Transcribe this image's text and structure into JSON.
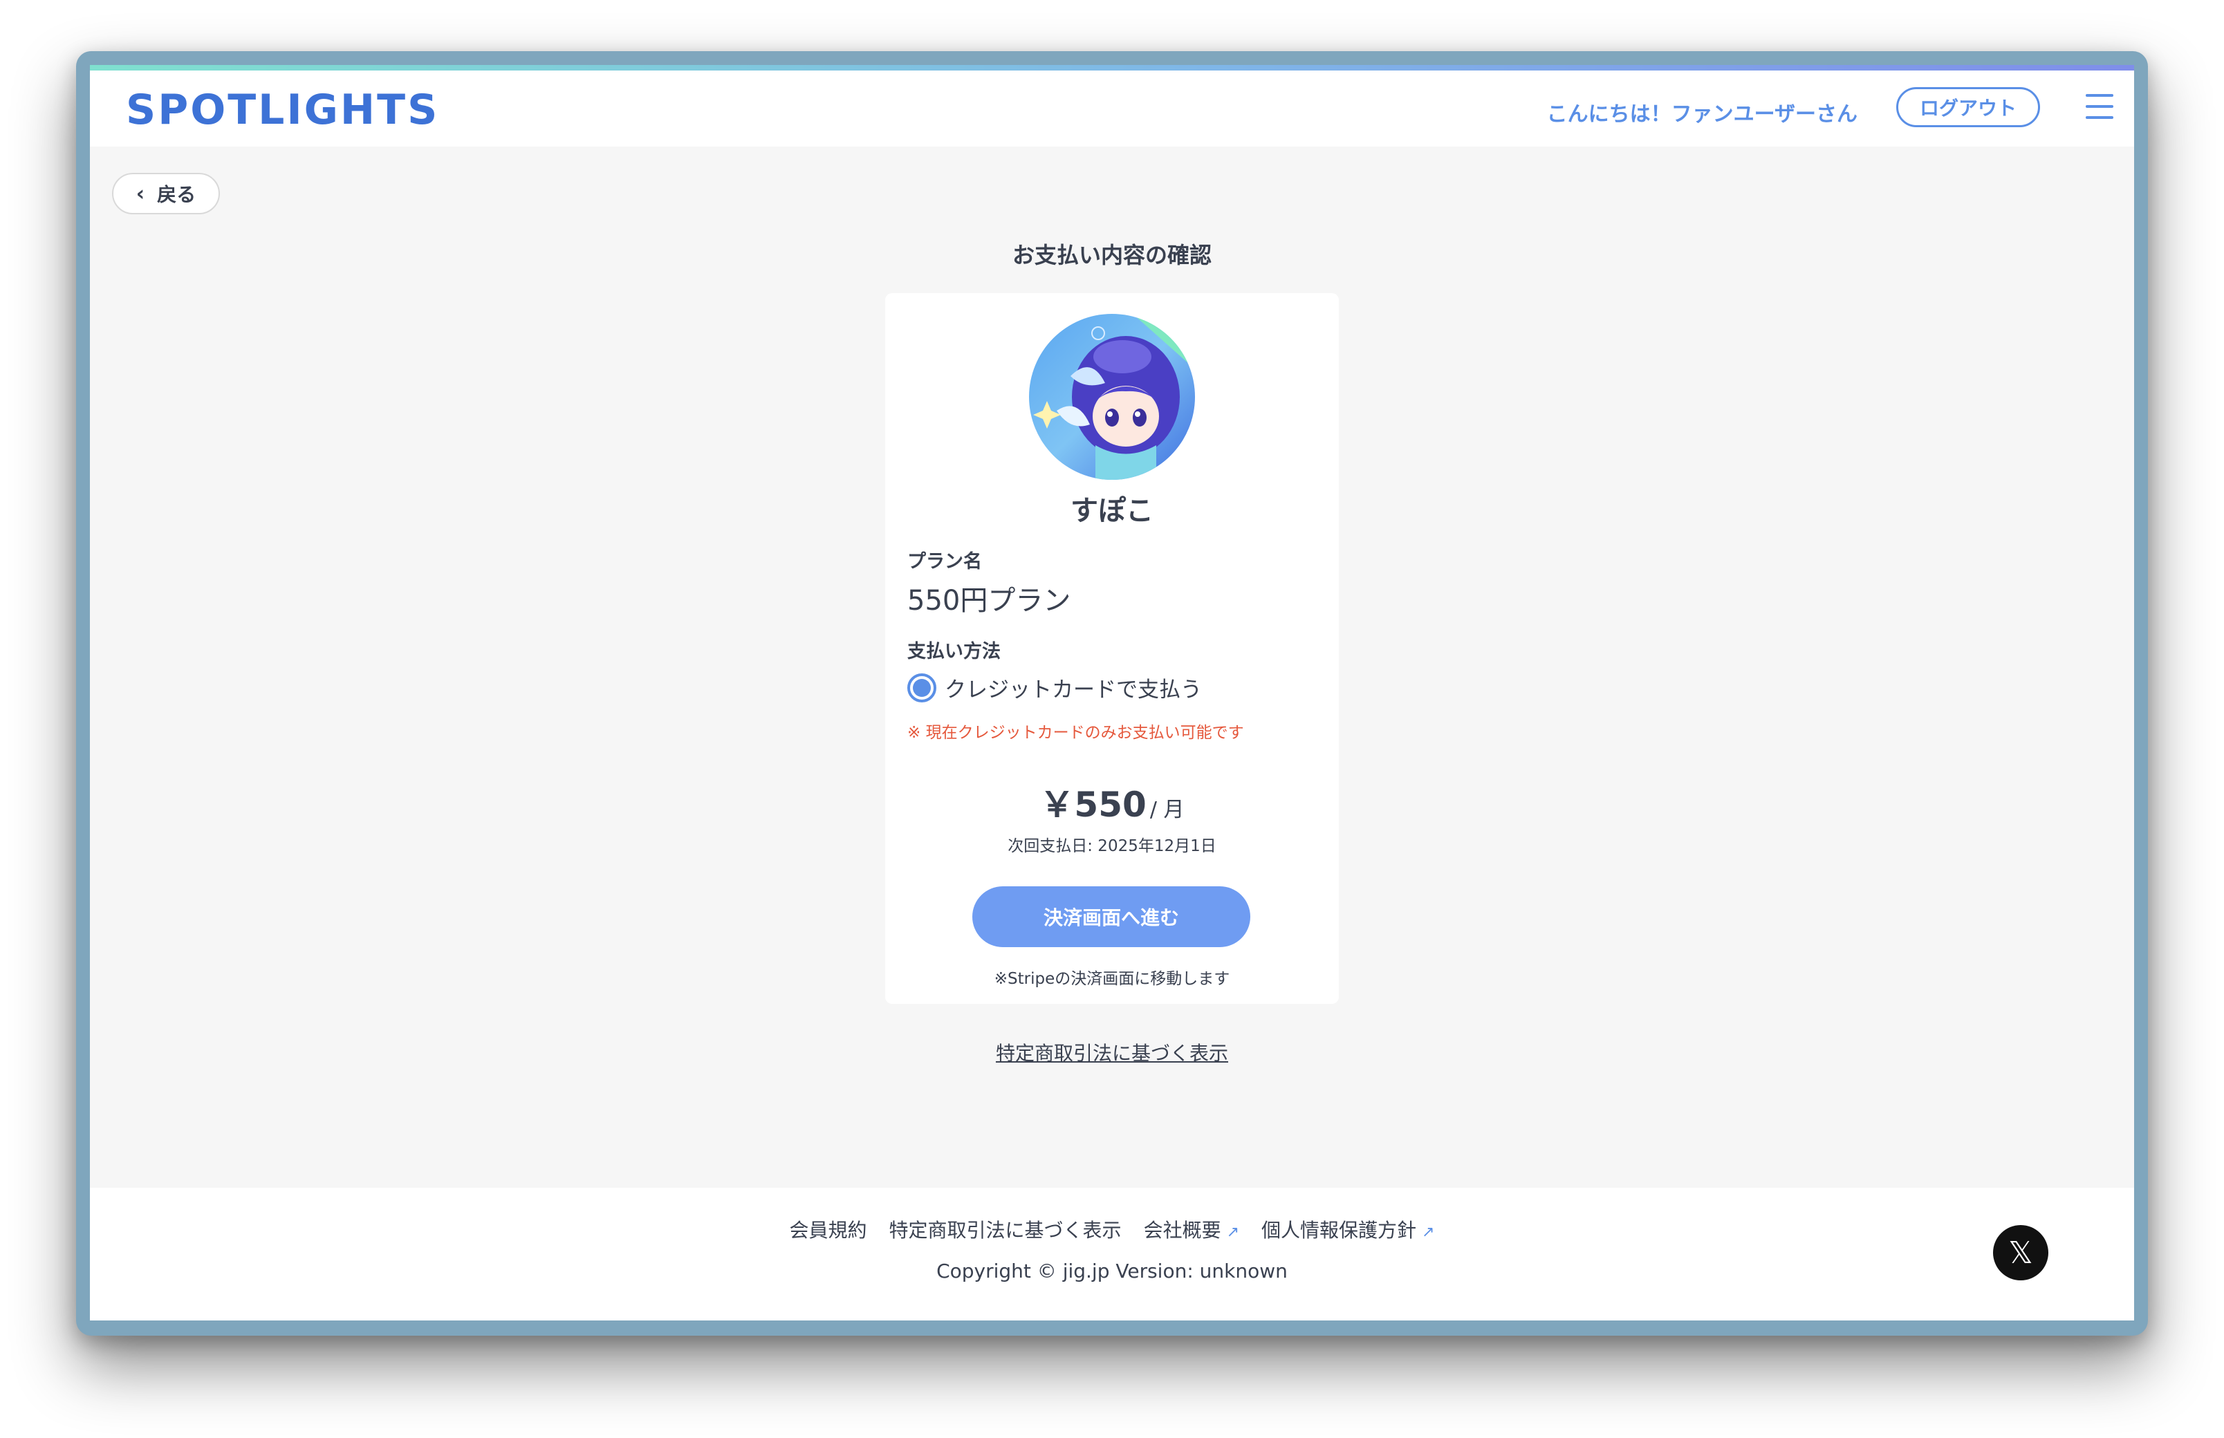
{
  "header": {
    "logo": "SPOTLIGHTS",
    "greeting": "こんにちは！ファンユーザーさん",
    "logout_label": "ログアウト",
    "menu_icon": "hamburger-menu-icon"
  },
  "back": {
    "label": "戻る",
    "icon": "chevron-left-icon"
  },
  "page_title": "お支払い内容の確認",
  "card": {
    "creator_name": "すぽこ",
    "plan_label": "プラン名",
    "plan_name": "550円プラン",
    "payment_label": "支払い方法",
    "payment_option": "クレジットカードで支払う",
    "payment_notice": "※ 現在クレジットカードのみお支払い可能です",
    "price_amount": "￥550",
    "price_unit": "/ 月",
    "next_payment": "次回支払日: 2025年12月1日",
    "pay_button": "決済画面へ進む",
    "stripe_note": "※Stripeの決済画面に移動します"
  },
  "tokushoho_link": "特定商取引法に基づく表示",
  "footer": {
    "links": [
      "会員規約",
      "特定商取引法に基づく表示",
      "会社概要",
      "個人情報保護方針"
    ],
    "copyright": "Copyright © jig.jp Version: unknown",
    "x_icon": "x-logo-icon"
  },
  "colors": {
    "accent": "#5a8fe6",
    "logo": "#3d72d6",
    "button": "#6f9cf2",
    "notice": "#e5583c",
    "text": "#3a4150"
  }
}
